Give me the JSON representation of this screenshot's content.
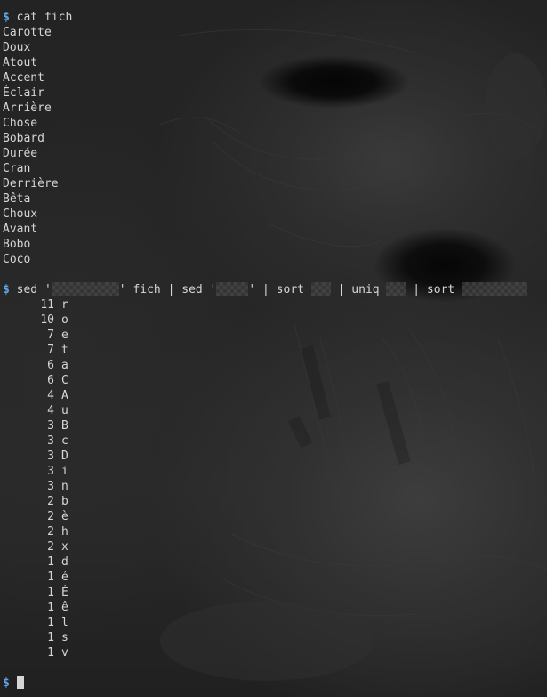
{
  "prompt_symbol": "$",
  "cmd1": "cat fich",
  "fich_lines": [
    "Carotte",
    "Doux",
    "Atout",
    "Accent",
    "Éclair",
    "Arrière",
    "Chose",
    "Bobard",
    "Durée",
    "Cran",
    "Derrière",
    "Bêta",
    "Choux",
    "Avant",
    "Bobo",
    "Coco"
  ],
  "cmd2": {
    "p1": "sed '",
    "p2": "' fich | sed '",
    "p3": "' | sort ",
    "p4": " | uniq ",
    "p5": " | sort "
  },
  "counts": [
    {
      "n": "11",
      "c": "r"
    },
    {
      "n": "10",
      "c": "o"
    },
    {
      "n": "7",
      "c": "e"
    },
    {
      "n": "7",
      "c": "t"
    },
    {
      "n": "6",
      "c": "a"
    },
    {
      "n": "6",
      "c": "C"
    },
    {
      "n": "4",
      "c": "A"
    },
    {
      "n": "4",
      "c": "u"
    },
    {
      "n": "3",
      "c": "B"
    },
    {
      "n": "3",
      "c": "c"
    },
    {
      "n": "3",
      "c": "D"
    },
    {
      "n": "3",
      "c": "i"
    },
    {
      "n": "3",
      "c": "n"
    },
    {
      "n": "2",
      "c": "b"
    },
    {
      "n": "2",
      "c": "è"
    },
    {
      "n": "2",
      "c": "h"
    },
    {
      "n": "2",
      "c": "x"
    },
    {
      "n": "1",
      "c": "d"
    },
    {
      "n": "1",
      "c": "é"
    },
    {
      "n": "1",
      "c": "É"
    },
    {
      "n": "1",
      "c": "ê"
    },
    {
      "n": "1",
      "c": "l"
    },
    {
      "n": "1",
      "c": "s"
    },
    {
      "n": "1",
      "c": "v"
    }
  ],
  "colors": {
    "prompt": "#5fa8e8",
    "text": "#d6d6d6"
  }
}
